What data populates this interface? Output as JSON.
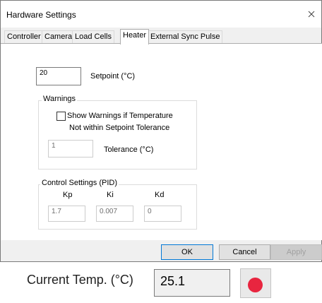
{
  "dialog": {
    "title": "Hardware Settings",
    "tabs": [
      "Controller",
      "Camera",
      "Load Cells",
      "Heater",
      "External Sync Pulse"
    ],
    "active_tab": "Heater"
  },
  "heater": {
    "setpoint_value": "20",
    "setpoint_label": "Setpoint (°C)",
    "warnings": {
      "title": "Warnings",
      "checkbox_label_line1": "Show Warnings if Temperature",
      "checkbox_label_line2": "Not within Setpoint Tolerance",
      "checkbox_checked": false,
      "tolerance_value": "1",
      "tolerance_label": "Tolerance (°C)"
    },
    "pid": {
      "title": "Control Settings (PID)",
      "kp_label": "Kp",
      "ki_label": "Ki",
      "kd_label": "Kd",
      "kp_value": "1.7",
      "ki_value": "0.007",
      "kd_value": "0"
    }
  },
  "buttons": {
    "ok": "OK",
    "cancel": "Cancel",
    "apply": "Apply"
  },
  "status": {
    "current_temp_label": "Current Temp. (°C)",
    "current_temp_value": "25.1",
    "record_color": "#e8253f"
  }
}
